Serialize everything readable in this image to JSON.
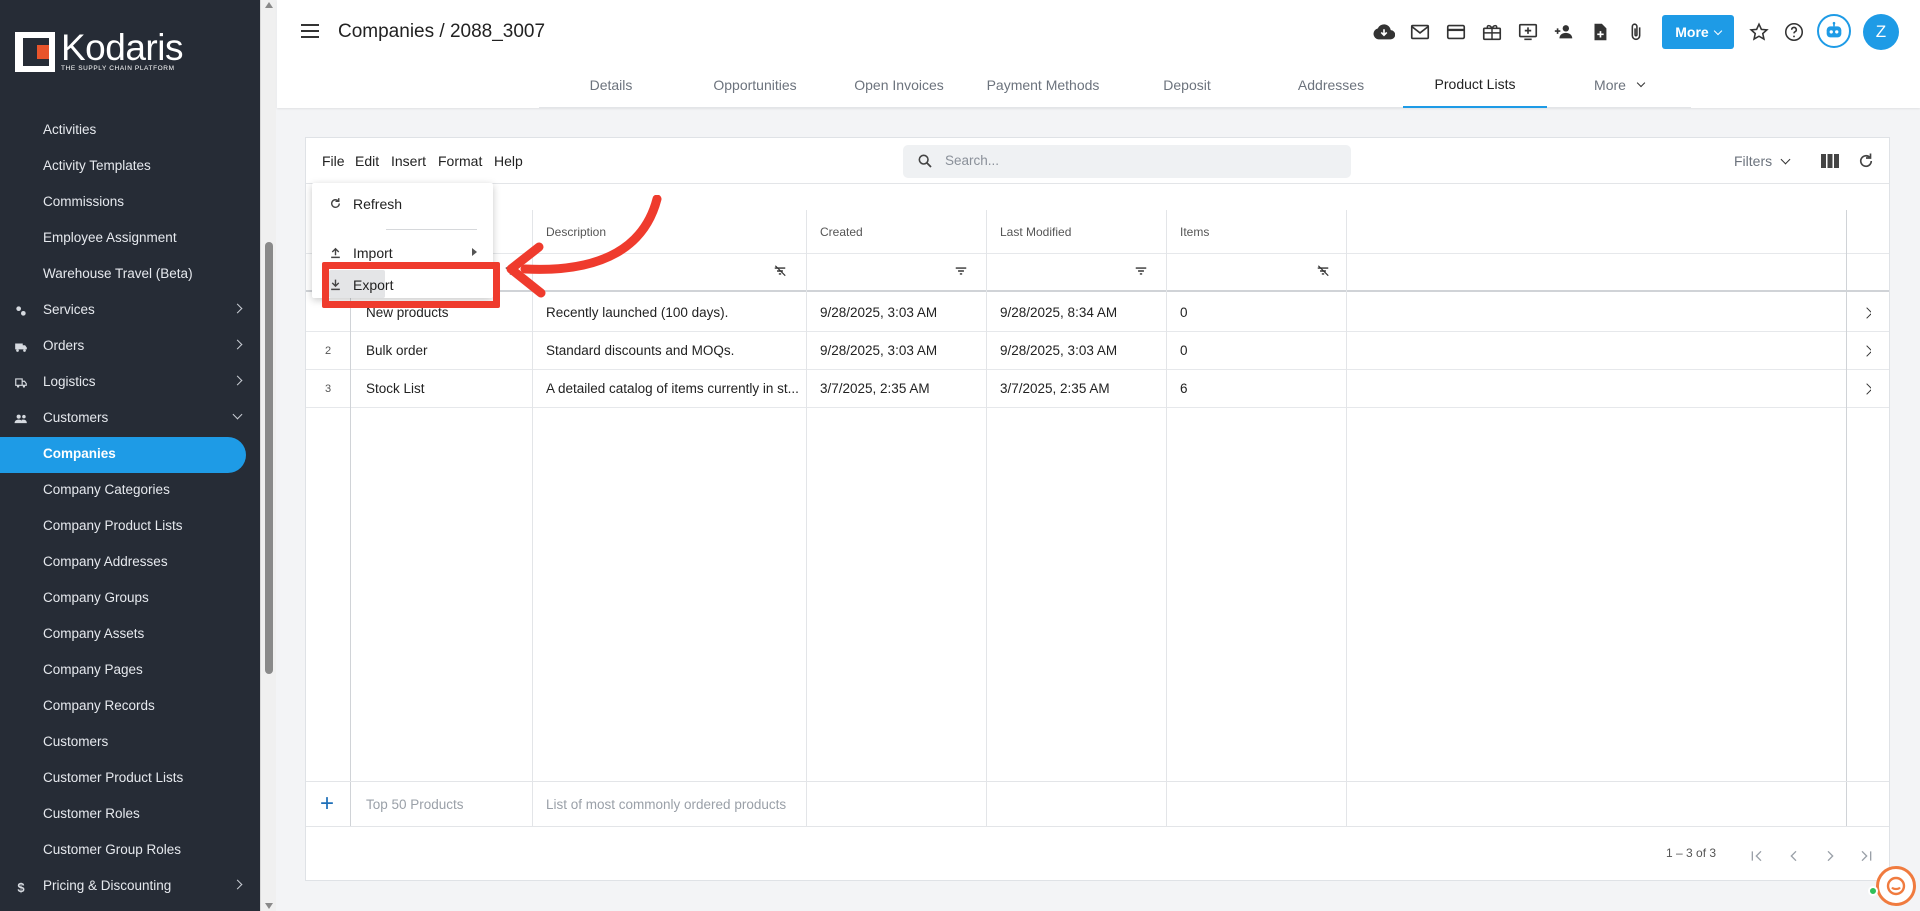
{
  "app": {
    "brand_name": "Kodaris",
    "brand_tagline": "THE SUPPLY CHAIN PLATFORM",
    "accent_color": "#1e9be6",
    "callout_color": "#ef3b2d"
  },
  "sidebar": {
    "items": [
      {
        "label": "Activities",
        "icon": null,
        "chevron": null
      },
      {
        "label": "Activity Templates",
        "icon": null,
        "chevron": null
      },
      {
        "label": "Commissions",
        "icon": null,
        "chevron": null
      },
      {
        "label": "Employee Assignment",
        "icon": null,
        "chevron": null
      },
      {
        "label": "Warehouse Travel (Beta)",
        "icon": null,
        "chevron": null
      },
      {
        "label": "Services",
        "icon": "services-icon",
        "chevron": "right"
      },
      {
        "label": "Orders",
        "icon": "truck-icon",
        "chevron": "right"
      },
      {
        "label": "Logistics",
        "icon": "logistics-icon",
        "chevron": "right"
      },
      {
        "label": "Customers",
        "icon": "people-icon",
        "chevron": "down"
      },
      {
        "label": "Companies",
        "icon": null,
        "chevron": null,
        "active": true
      },
      {
        "label": "Company Categories",
        "icon": null,
        "chevron": null
      },
      {
        "label": "Company Product Lists",
        "icon": null,
        "chevron": null
      },
      {
        "label": "Company Addresses",
        "icon": null,
        "chevron": null
      },
      {
        "label": "Company Groups",
        "icon": null,
        "chevron": null
      },
      {
        "label": "Company Assets",
        "icon": null,
        "chevron": null
      },
      {
        "label": "Company Pages",
        "icon": null,
        "chevron": null
      },
      {
        "label": "Company Records",
        "icon": null,
        "chevron": null
      },
      {
        "label": "Customers",
        "icon": null,
        "chevron": null
      },
      {
        "label": "Customer Product Lists",
        "icon": null,
        "chevron": null
      },
      {
        "label": "Customer Roles",
        "icon": null,
        "chevron": null
      },
      {
        "label": "Customer Group Roles",
        "icon": null,
        "chevron": null
      },
      {
        "label": "Pricing & Discounting",
        "icon": "dollar-icon",
        "chevron": "right"
      }
    ]
  },
  "header": {
    "title": "Companies / 2088_3007",
    "more_label": "More",
    "avatar_initial": "Z",
    "icons": [
      "cloud-download-icon",
      "mail-icon",
      "card-icon",
      "gift-icon",
      "add-screen-icon",
      "add-person-icon",
      "add-file-icon",
      "paperclip-icon"
    ]
  },
  "tabs": [
    {
      "label": "Details"
    },
    {
      "label": "Opportunities"
    },
    {
      "label": "Open Invoices"
    },
    {
      "label": "Payment Methods"
    },
    {
      "label": "Deposit"
    },
    {
      "label": "Addresses"
    },
    {
      "label": "Product Lists",
      "active": true
    },
    {
      "label": "More",
      "dropdown": true
    }
  ],
  "menubar": {
    "file": "File",
    "edit": "Edit",
    "insert": "Insert",
    "format": "Format",
    "help": "Help"
  },
  "search": {
    "placeholder": "Search..."
  },
  "filters_label": "Filters",
  "file_menu": {
    "refresh": "Refresh",
    "import": "Import",
    "export": "Export"
  },
  "table": {
    "columns": [
      "Description",
      "Created",
      "Last Modified",
      "Items"
    ],
    "rows": [
      {
        "num": "",
        "name": "New products",
        "description": "Recently launched (100 days).",
        "created": "9/28/2025, 3:03 AM",
        "modified": "9/28/2025, 8:34 AM",
        "items": "0"
      },
      {
        "num": "2",
        "name": "Bulk order",
        "description": "Standard discounts and MOQs.",
        "created": "9/28/2025, 3:03 AM",
        "modified": "9/28/2025, 3:03 AM",
        "items": "0"
      },
      {
        "num": "3",
        "name": "Stock List",
        "description": "A detailed catalog of items currently in st...",
        "created": "3/7/2025, 2:35 AM",
        "modified": "3/7/2025, 2:35 AM",
        "items": "6"
      }
    ],
    "new_row": {
      "name_placeholder": "Top 50 Products",
      "description_placeholder": "List of most commonly ordered products"
    }
  },
  "pager": {
    "range": "1 – 3 of 3"
  }
}
